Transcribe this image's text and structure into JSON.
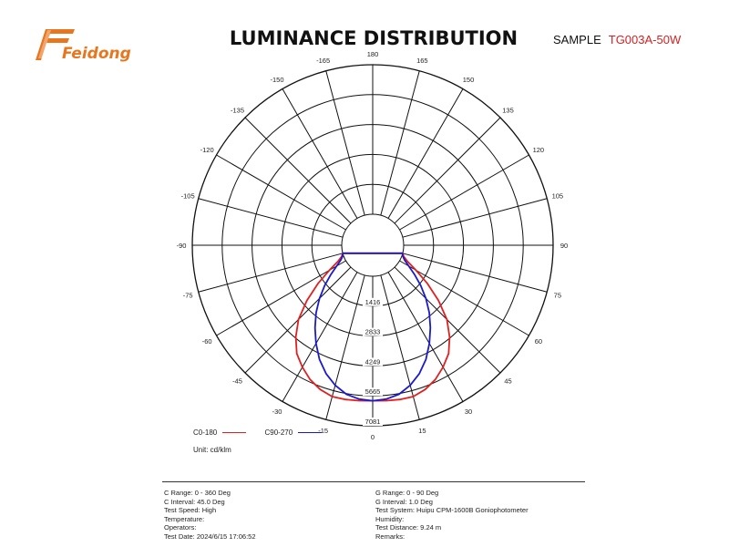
{
  "header": {
    "logo_text": "Feidong",
    "title": "LUMINANCE DISTRIBUTION",
    "sample_label": "SAMPLE",
    "sample_code": "TG003A-50W",
    "colors": {
      "logo": "#e8761e",
      "sample_code": "#d62020"
    }
  },
  "chart_data": {
    "type": "polar",
    "angle_labels": [
      {
        "deg": 180,
        "label": "180"
      },
      {
        "deg": 165,
        "label": "165"
      },
      {
        "deg": 150,
        "label": "150"
      },
      {
        "deg": 135,
        "label": "135"
      },
      {
        "deg": 120,
        "label": "120"
      },
      {
        "deg": 105,
        "label": "105"
      },
      {
        "deg": 90,
        "label": "90"
      },
      {
        "deg": 75,
        "label": "75"
      },
      {
        "deg": 60,
        "label": "60"
      },
      {
        "deg": 45,
        "label": "45"
      },
      {
        "deg": 30,
        "label": "30"
      },
      {
        "deg": 15,
        "label": "15"
      },
      {
        "deg": 0,
        "label": "0"
      },
      {
        "deg": -15,
        "label": "-15"
      },
      {
        "deg": -30,
        "label": "-30"
      },
      {
        "deg": -45,
        "label": "-45"
      },
      {
        "deg": -60,
        "label": "-60"
      },
      {
        "deg": -75,
        "label": "-75"
      },
      {
        "deg": -90,
        "label": "-90"
      },
      {
        "deg": -105,
        "label": "-105"
      },
      {
        "deg": -120,
        "label": "-120"
      },
      {
        "deg": -135,
        "label": "-135"
      },
      {
        "deg": -150,
        "label": "-150"
      },
      {
        "deg": -165,
        "label": "-165"
      }
    ],
    "radial_ticks": [
      {
        "value": 1416,
        "label": "1416"
      },
      {
        "value": 2833,
        "label": "2833"
      },
      {
        "value": 4249,
        "label": "4249"
      },
      {
        "value": 5665,
        "label": "5665"
      },
      {
        "value": 7081,
        "label": "7081"
      }
    ],
    "r_max": 7081,
    "unit": "Unit: cd/klm",
    "grid": true,
    "series": [
      {
        "name": "C0-180",
        "color": "#e02020",
        "points": [
          {
            "angle": 0,
            "value": 5900
          },
          {
            "angle": 5,
            "value": 5920
          },
          {
            "angle": 10,
            "value": 5950
          },
          {
            "angle": 15,
            "value": 5950
          },
          {
            "angle": 20,
            "value": 5800
          },
          {
            "angle": 25,
            "value": 5550
          },
          {
            "angle": 30,
            "value": 5200
          },
          {
            "angle": 35,
            "value": 4800
          },
          {
            "angle": 40,
            "value": 4200
          },
          {
            "angle": 45,
            "value": 3500
          },
          {
            "angle": 50,
            "value": 2600
          },
          {
            "angle": 55,
            "value": 1700
          },
          {
            "angle": 60,
            "value": 900
          },
          {
            "angle": 65,
            "value": 350
          },
          {
            "angle": 70,
            "value": 100
          },
          {
            "angle": 75,
            "value": 0
          }
        ]
      },
      {
        "name": "C90-270",
        "color": "#1a1acc",
        "points": [
          {
            "angle": 0,
            "value": 5900
          },
          {
            "angle": 5,
            "value": 5850
          },
          {
            "angle": 10,
            "value": 5700
          },
          {
            "angle": 15,
            "value": 5400
          },
          {
            "angle": 20,
            "value": 5000
          },
          {
            "angle": 25,
            "value": 4500
          },
          {
            "angle": 30,
            "value": 3900
          },
          {
            "angle": 35,
            "value": 3300
          },
          {
            "angle": 40,
            "value": 2700
          },
          {
            "angle": 45,
            "value": 2100
          },
          {
            "angle": 50,
            "value": 1500
          },
          {
            "angle": 55,
            "value": 950
          },
          {
            "angle": 60,
            "value": 500
          },
          {
            "angle": 65,
            "value": 200
          },
          {
            "angle": 70,
            "value": 50
          },
          {
            "angle": 75,
            "value": 0
          }
        ]
      }
    ]
  },
  "legend": {
    "c0_label": "C0-180",
    "c90_label": "C90-270",
    "unit": "Unit: cd/klm"
  },
  "info": {
    "left": [
      "C Range: 0 - 360 Deg",
      "C Interval: 45.0 Deg",
      "Test Speed: High",
      "Temperature:",
      "Operators:",
      "Test Date: 2024/6/15 17:06:52"
    ],
    "right": [
      "G Range: 0 - 90 Deg",
      "G Interval: 1.0 Deg",
      "Test System: Huipu CPM-1600B Goniophotometer",
      "Humidity:",
      "Test Distance: 9.24 m",
      "Remarks:"
    ]
  }
}
